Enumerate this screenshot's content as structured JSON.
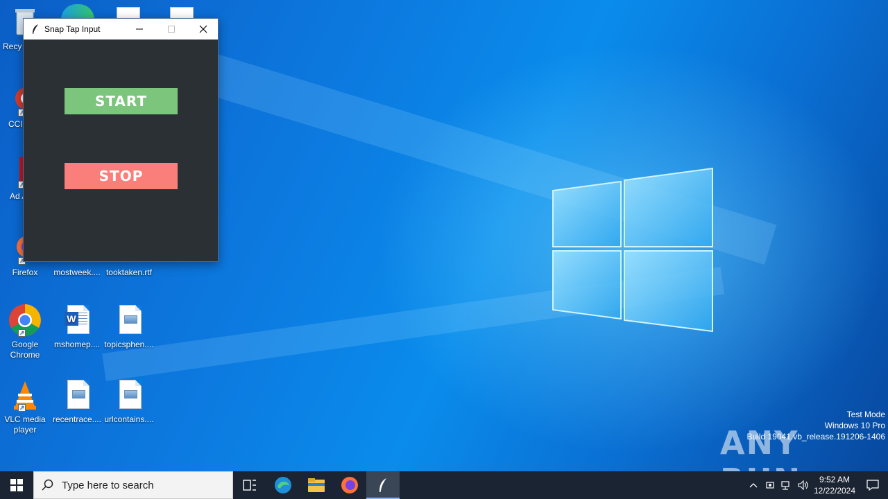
{
  "window": {
    "title": "Snap Tap Input",
    "start_label": "START",
    "stop_label": "STOP"
  },
  "desktop_icons": [
    {
      "label": "Recy",
      "icon": "recycle-bin-icon"
    },
    {
      "label": "CCl",
      "icon": "ccleaner-icon"
    },
    {
      "label": "Ad Acr",
      "icon": "acrobat-icon"
    },
    {
      "label": "Firefox",
      "icon": "firefox-icon"
    },
    {
      "label": "mostweek....",
      "icon": "document-icon"
    },
    {
      "label": "tooktaken.rtf",
      "icon": "document-icon"
    },
    {
      "label": "Google Chrome",
      "icon": "chrome-icon"
    },
    {
      "label": "mshomep....",
      "icon": "word-icon"
    },
    {
      "label": "topicsphen....",
      "icon": "image-file-icon"
    },
    {
      "label": "VLC media player",
      "icon": "vlc-icon"
    },
    {
      "label": "recentrace....",
      "icon": "image-file-icon"
    },
    {
      "label": "urlcontains....",
      "icon": "image-file-icon"
    }
  ],
  "watermark": {
    "brand": "ANY RUN",
    "line1": "Test Mode",
    "line2": "Windows 10 Pro",
    "line3": "Build 19041.vb_release.191206-1406"
  },
  "taskbar": {
    "search_placeholder": "Type here to search",
    "time": "9:52 AM",
    "date": "12/22/2024"
  },
  "colors": {
    "start_button": "#7cc57c",
    "stop_button": "#fa7f7a",
    "window_body": "#2b3035",
    "taskbar": "#1b2433"
  }
}
